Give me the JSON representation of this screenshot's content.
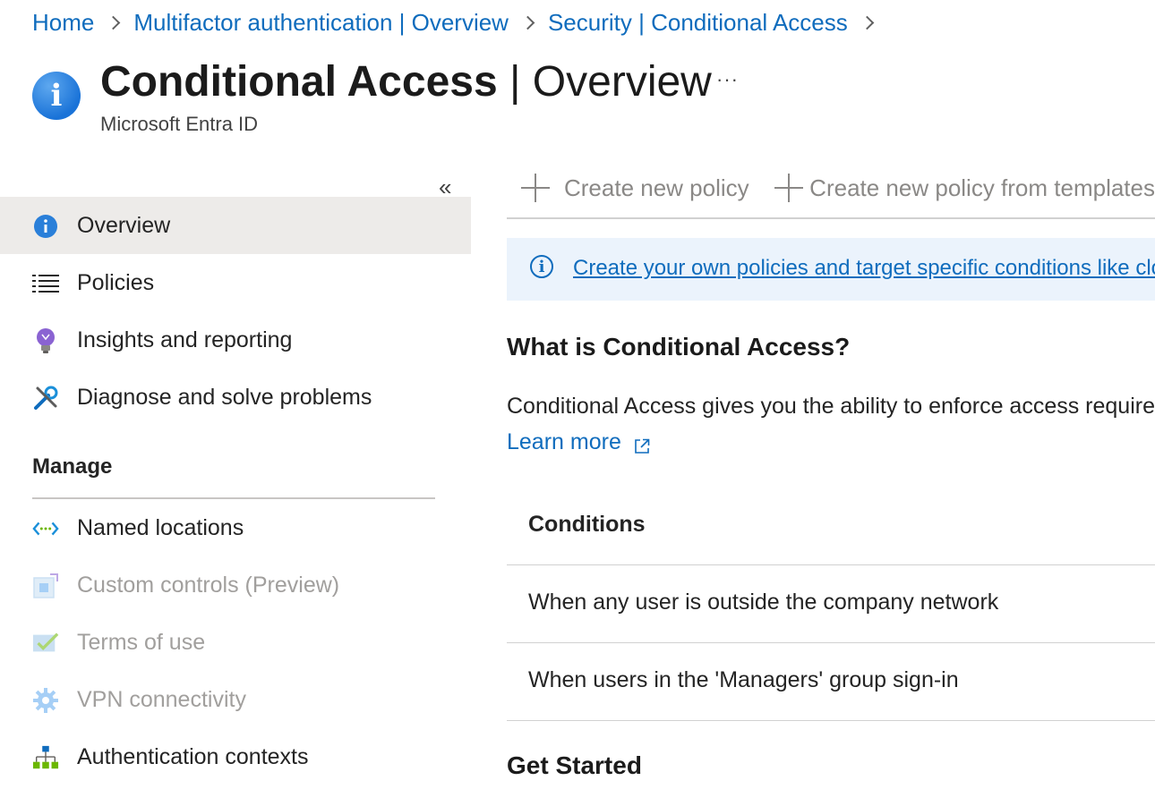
{
  "breadcrumb": {
    "items": [
      "Home",
      "Multifactor authentication | Overview",
      "Security | Conditional Access"
    ]
  },
  "header": {
    "title_bold": "Conditional Access",
    "title_rest": " | Overview",
    "subtitle": "Microsoft Entra ID",
    "more": "···",
    "icon": "info-icon"
  },
  "sidebar": {
    "collapse": "«",
    "items": [
      {
        "label": "Overview",
        "icon": "info-icon",
        "selected": true
      },
      {
        "label": "Policies",
        "icon": "list-icon"
      },
      {
        "label": "Insights and reporting",
        "icon": "lightbulb-icon"
      },
      {
        "label": "Diagnose and solve problems",
        "icon": "wrench-icon"
      }
    ],
    "section": "Manage",
    "manage_items": [
      {
        "label": "Named locations",
        "icon": "network-arrows-icon",
        "disabled": false
      },
      {
        "label": "Custom controls (Preview)",
        "icon": "custom-controls-icon",
        "disabled": true
      },
      {
        "label": "Terms of use",
        "icon": "checkmark-doc-icon",
        "disabled": true
      },
      {
        "label": "VPN connectivity",
        "icon": "gear-icon",
        "disabled": true
      },
      {
        "label": "Authentication contexts",
        "icon": "hierarchy-icon",
        "disabled": false
      }
    ]
  },
  "toolbar": {
    "create_policy": "Create new policy",
    "create_from_templates": "Create new policy from templates"
  },
  "banner": {
    "text": "Create your own policies and target specific conditions like cloud apps, sign-in risk, and device platforms"
  },
  "content": {
    "what_heading": "What is Conditional Access?",
    "description": "Conditional Access gives you the ability to enforce access requirements when specific conditions occur.",
    "learn_more": "Learn more",
    "conditions": {
      "header": "Conditions",
      "rows": [
        "When any user is outside the company network",
        "When users in the 'Managers' group sign-in"
      ]
    },
    "get_started_heading": "Get Started"
  },
  "colors": {
    "link": "#0f6cbd",
    "selected_bg": "#edebe9",
    "banner_bg": "#ebf3fc",
    "disabled_text": "#a19f9d"
  }
}
